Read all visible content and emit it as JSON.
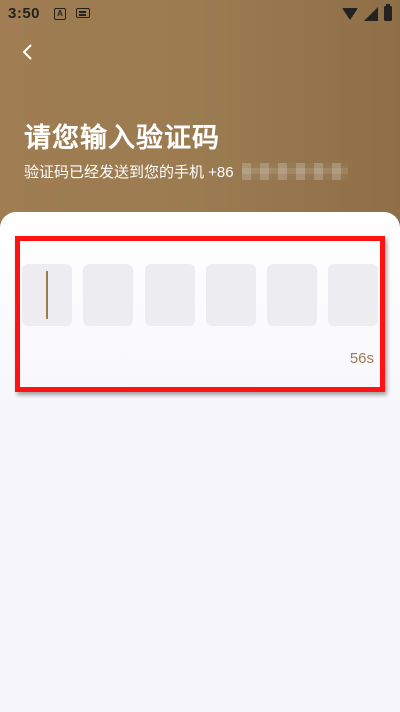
{
  "status_bar": {
    "time": "3:50",
    "icons": [
      "a-notification-icon",
      "keyboard-icon",
      "wifi-icon",
      "signal-icon",
      "battery-icon"
    ]
  },
  "header": {
    "back_icon": "chevron-left-icon",
    "title": "请您输入验证码",
    "subtitle": "验证码已经发送到您的手机 +86"
  },
  "code_input": {
    "digits": [
      "",
      "",
      "",
      "",
      "",
      ""
    ],
    "active_index": 0,
    "cursor_color": "#9b7b50"
  },
  "countdown": {
    "label": "56s",
    "color": "#9b7b50"
  },
  "colors": {
    "header_bg": "#9b7b50",
    "highlight_border": "#ff1212",
    "box_bg": "#ededf1"
  }
}
